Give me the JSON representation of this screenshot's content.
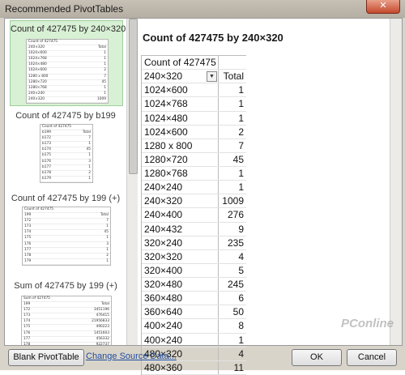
{
  "window": {
    "title": "Recommended PivotTables",
    "close_glyph": "✕"
  },
  "left_panel": {
    "recommendations": [
      {
        "title": "Count of 427475 by 240×320",
        "thumb_header": [
          "Count of 427475",
          "240×320",
          "Total"
        ],
        "thumb_rows": [
          [
            "1024×600",
            "1"
          ],
          [
            "1024×768",
            "1"
          ],
          [
            "1024×480",
            "1"
          ],
          [
            "1024×600",
            "2"
          ],
          [
            "1280 x 800",
            "7"
          ],
          [
            "1280×720",
            "45"
          ],
          [
            "1280×768",
            "1"
          ],
          [
            "240×240",
            "1"
          ],
          [
            "240×320",
            "1009"
          ]
        ]
      },
      {
        "title": "Count of 427475 by b199",
        "thumb_header": [
          "Count of 427475",
          "b199",
          "Total"
        ],
        "thumb_rows": [
          [
            "b172",
            "7"
          ],
          [
            "b173",
            "1"
          ],
          [
            "b174",
            "45"
          ],
          [
            "b175",
            "1"
          ],
          [
            "b176",
            "3"
          ],
          [
            "b177",
            "1"
          ],
          [
            "b178",
            "2"
          ],
          [
            "b179",
            "1"
          ]
        ]
      },
      {
        "title": "Count of 427475 by 199 (+)",
        "thumb_header": [
          "Count of 427475",
          "199",
          "Total"
        ],
        "thumb_rows": [
          [
            "172",
            "7"
          ],
          [
            "173",
            "1"
          ],
          [
            "174",
            "45"
          ],
          [
            "175",
            "1"
          ],
          [
            "176",
            "3"
          ],
          [
            "177",
            "1"
          ],
          [
            "178",
            "2"
          ],
          [
            "179",
            "1"
          ]
        ]
      },
      {
        "title": "Sum of 427475 by 199 (+)",
        "thumb_header": [
          "Sum of 427475",
          "199",
          "Total"
        ],
        "thumb_rows": [
          [
            "172",
            "3451196"
          ],
          [
            "173",
            "476415"
          ],
          [
            "174",
            "21956833"
          ],
          [
            "175",
            "490223"
          ],
          [
            "176",
            "1451603"
          ],
          [
            "177",
            "456332"
          ],
          [
            "178",
            "922737"
          ]
        ]
      }
    ]
  },
  "preview": {
    "heading": "Count of 427475 by 240×320",
    "header_row1": "Count of 427475",
    "col_label": "240×320",
    "col_total": "Total",
    "rows": [
      [
        "1024×600",
        "1"
      ],
      [
        "1024×768",
        "1"
      ],
      [
        "1024×480",
        "1"
      ],
      [
        "1024×600",
        "2"
      ],
      [
        "1280 x 800",
        "7"
      ],
      [
        "1280×720",
        "45"
      ],
      [
        "1280×768",
        "1"
      ],
      [
        "240×240",
        "1"
      ],
      [
        "240×320",
        "1009"
      ],
      [
        "240×400",
        "276"
      ],
      [
        "240×432",
        "9"
      ],
      [
        "320×240",
        "235"
      ],
      [
        "320×320",
        "4"
      ],
      [
        "320×400",
        "5"
      ],
      [
        "320×480",
        "245"
      ],
      [
        "360×480",
        "6"
      ],
      [
        "360×640",
        "50"
      ],
      [
        "400×240",
        "8"
      ],
      [
        "400×240",
        "1"
      ],
      [
        "480×320",
        "4"
      ],
      [
        "480×360",
        "11"
      ]
    ]
  },
  "footer": {
    "blank_button": "Blank PivotTable",
    "change_source_link": "Change Source Data...",
    "ok_button": "OK",
    "cancel_button": "Cancel",
    "watermark": "PConline"
  }
}
